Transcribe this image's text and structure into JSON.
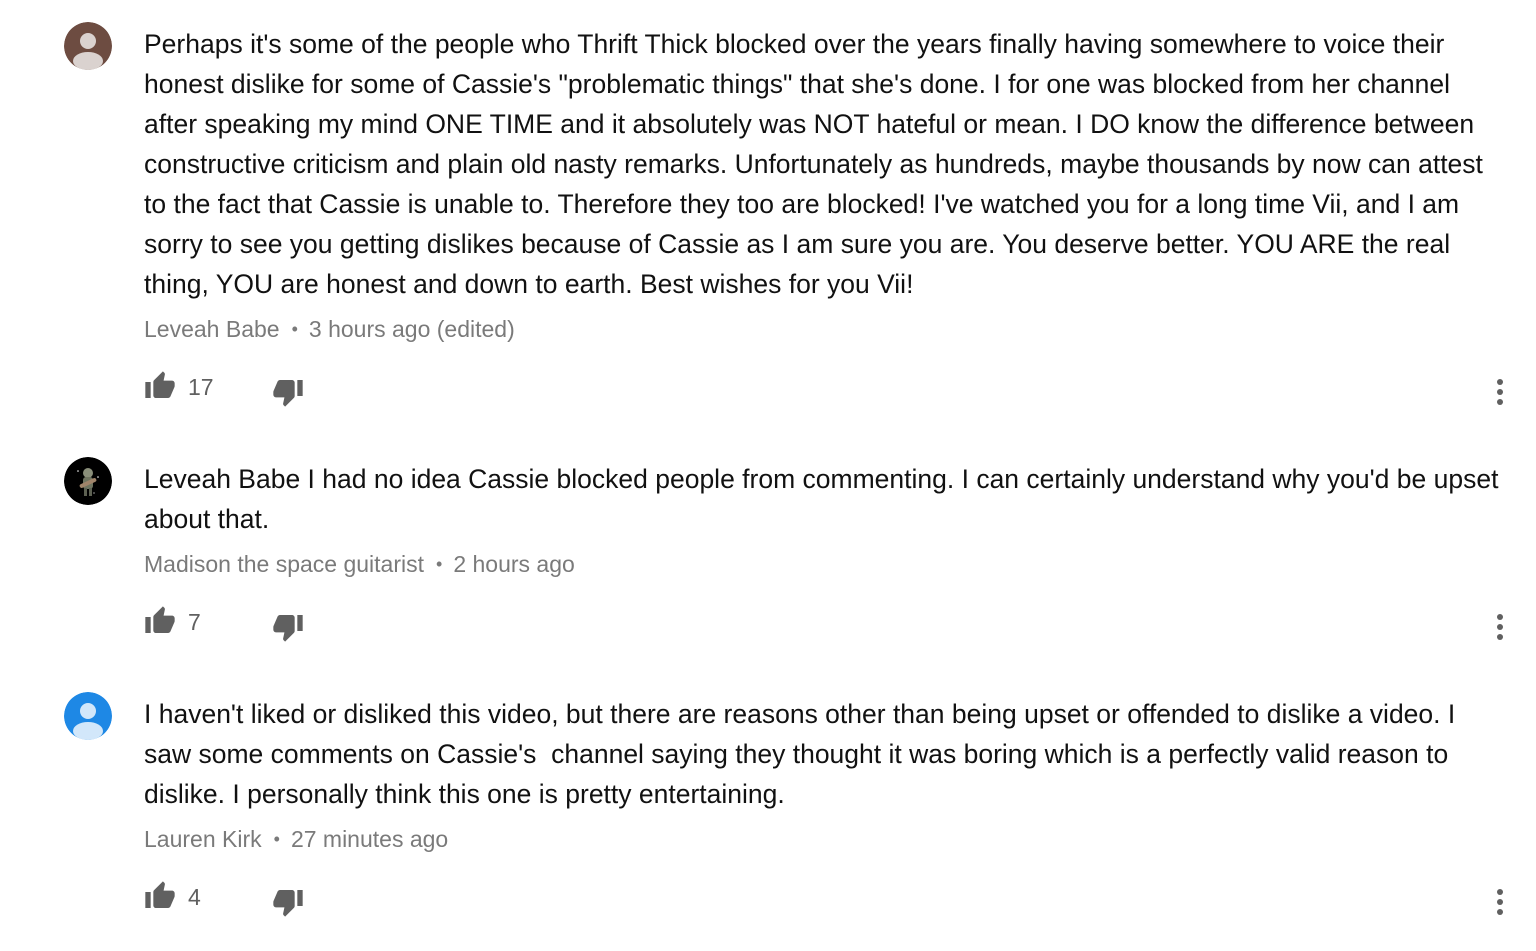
{
  "comments": [
    {
      "author": "Leveah Babe",
      "time": "3 hours ago (edited)",
      "text": "Perhaps it's some of the people who Thrift Thick blocked over the years finally having somewhere to voice their honest dislike for some of Cassie's \"problematic things\" that she's done. I for one was blocked from her channel after speaking my mind ONE TIME and it absolutely was NOT hateful or mean. I DO know the difference between constructive criticism and plain old nasty remarks. Unfortunately as hundreds, maybe thousands by now can attest to the fact that Cassie is unable to. Therefore they too are blocked! I've watched you for a long time Vii, and I am sorry to see you getting dislikes because of Cassie as I am sure you are. You deserve better. YOU ARE the real thing, YOU are honest and down to earth. Best wishes for you Vii!",
      "likes": "17",
      "avatar_icon": "default-user-avatar-icon",
      "avatar_color": "#6d4c41"
    },
    {
      "author": "Madison the space guitarist",
      "time": "2 hours ago",
      "text": "Leveah Babe I had no idea Cassie blocked people from commenting. I can certainly understand why you'd be upset about that.",
      "likes": "7",
      "avatar_icon": "astronaut-guitarist-avatar-icon",
      "avatar_color": "#000000"
    },
    {
      "author": "Lauren Kirk",
      "time": "27 minutes ago",
      "text": "I haven't liked or disliked this video, but there are reasons other than being upset or offended to dislike a video. I saw some comments on Cassie's  channel saying they thought it was boring which is a perfectly valid reason to dislike. I personally think this one is pretty entertaining.",
      "likes": "4",
      "avatar_icon": "default-user-avatar-icon",
      "avatar_color": "#1e88e5"
    }
  ],
  "icons": {
    "like": "thumb-up-icon",
    "dislike": "thumb-down-icon",
    "menu": "more-vertical-icon"
  },
  "colors": {
    "meta_text": "#7a7a7a",
    "icon": "#606060",
    "body_text": "#111111"
  }
}
